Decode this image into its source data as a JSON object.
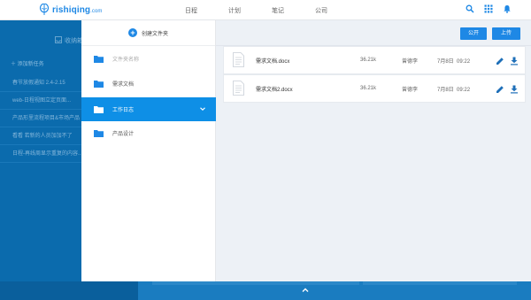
{
  "app": {
    "brand": "rishiqing",
    "brand_suffix": ".com",
    "nav": [
      "日程",
      "计划",
      "笔记",
      "公司"
    ]
  },
  "background": {
    "header": "收纳箱",
    "add_label": "添加新任务",
    "items": [
      "春节放假通知 2.4-2.15",
      "web-日程视图立定页面...",
      "产品形里流程项目&市场产品",
      "看看 若新的人员加加不了",
      "日程-再线周显示重复的内容..."
    ]
  },
  "folders": {
    "create_label": "创建文件夹",
    "placeholder": "文件夹名称",
    "items": [
      {
        "label": "需求文档",
        "active": false
      },
      {
        "label": "工作日志",
        "active": true
      },
      {
        "label": "产品设计",
        "active": false
      }
    ]
  },
  "files": {
    "public_label": "公开",
    "upload_label": "上传",
    "rows": [
      {
        "name": "需求文档.docx",
        "size": "36.21k",
        "owner": "曾德李",
        "date": "7月8日",
        "time": "09:22"
      },
      {
        "name": "需求文档2.docx",
        "size": "36.21k",
        "owner": "曾德李",
        "date": "7月8日",
        "time": "09:22"
      }
    ]
  },
  "icons": {
    "search": "search-icon",
    "apps": "apps-grid-icon",
    "notifications": "bell-icon",
    "expand": "chevron-up-icon"
  },
  "colors": {
    "accent": "#1e88e5",
    "active_folder": "#0e8fe6",
    "overlay": "#0b6bad"
  }
}
